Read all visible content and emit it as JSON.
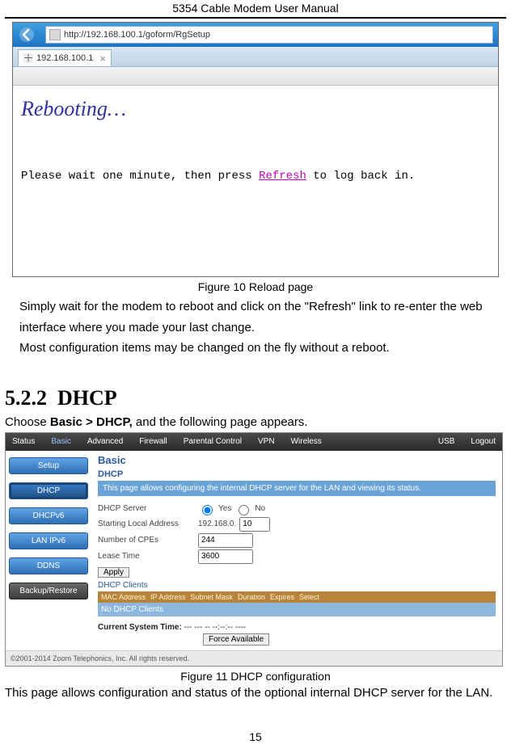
{
  "doc": {
    "header": "5354 Cable Modem User Manual",
    "fig10_caption": "Figure 10 Reload page",
    "para1": "Simply wait for the modem to reboot and click on the \"Refresh\" link to re-enter the web interface where you made your last change.",
    "para2": "Most configuration items may be changed on the fly without a reboot.",
    "section_num": "5.2.2",
    "section_title": "DHCP",
    "intro_pre": "Choose ",
    "intro_bold": "Basic > DHCP,",
    "intro_post": " and the following page appears.",
    "fig11_caption": "Figure 11 DHCP configuration",
    "para3": "This page allows configuration and status of the optional internal DHCP server for the LAN.",
    "page_number": "15"
  },
  "shot1": {
    "url": "http://192.168.100.1/goform/RgSetup",
    "tab_label": "192.168.100.1",
    "heading": "Rebooting",
    "dots": "…",
    "msg_pre": "Please wait one minute, then press ",
    "msg_link": "Refresh",
    "msg_post": " to log back in."
  },
  "shot2": {
    "menu": {
      "status": "Status",
      "basic": "Basic",
      "advanced": "Advanced",
      "firewall": "Firewall",
      "parental": "Parental Control",
      "vpn": "VPN",
      "wireless": "Wireless",
      "usb": "USB",
      "logout": "Logout"
    },
    "side": {
      "setup": "Setup",
      "dhcp": "DHCP",
      "dhcpv6": "DHCPv6",
      "lanipv6": "LAN IPv6",
      "ddns": "DDNS",
      "backup": "Backup/Restore"
    },
    "bc": "Basic",
    "sub": "DHCP",
    "desc": "This page allows configuring the internal DHCP server for the LAN and viewing its status.",
    "rows": {
      "dhcp_server_label": "DHCP Server",
      "yes": "Yes",
      "no": "No",
      "start_label": "Starting Local Address",
      "start_prefix": "192.168.0.",
      "start_val": "10",
      "cpes_label": "Number of CPEs",
      "cpes_val": "244",
      "lease_label": "Lease Time",
      "lease_val": "3600",
      "apply": "Apply"
    },
    "clients_hdr": "DHCP Clients",
    "tbl": {
      "c1": "MAC Address",
      "c2": "IP Address",
      "c3": "Subnet Mask",
      "c4": "Duration",
      "c5": "Expires",
      "c6": "Select"
    },
    "no_clients": "No DHCP Clients",
    "curtime_label": "Current System Time:",
    "curtime_val": "--- --- -- --:--:-- ----",
    "force": "Force Available",
    "footer": "©2001-2014 Zoom Telephonics, Inc. All rights reserved."
  }
}
